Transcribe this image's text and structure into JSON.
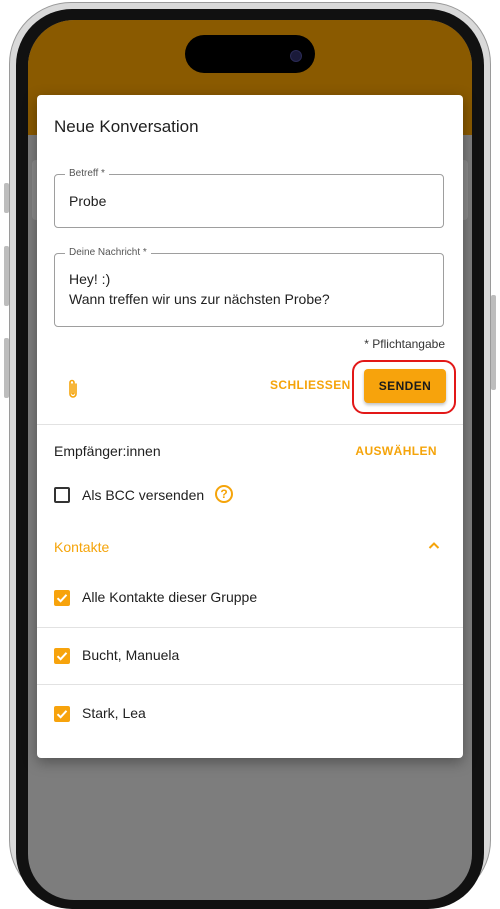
{
  "dialog": {
    "title": "Neue Konversation",
    "subject_label": "Betreff *",
    "subject_value": "Probe",
    "message_label": "Deine Nachricht *",
    "message_value": "Hey! :)\nWann treffen wir uns zur nächsten Probe?",
    "required_note": "* Pflichtangabe",
    "close_label": "SCHLIESSEN",
    "send_label": "SENDEN",
    "recipients_label": "Empfänger:innen",
    "select_label": "AUSWÄHLEN",
    "bcc_label": "Als BCC versenden",
    "help_glyph": "?",
    "contacts_title": "Kontakte",
    "contacts": [
      {
        "label": "Alle Kontakte dieser Gruppe",
        "checked": true
      },
      {
        "label": "Bucht, Manuela",
        "checked": true
      },
      {
        "label": "Stark, Lea",
        "checked": true
      }
    ]
  },
  "icons": [
    "paperclip-icon",
    "help-icon",
    "chevron-up-icon",
    "check-icon"
  ],
  "colors": {
    "accent": "#f7a30c",
    "header": "#8a5a00",
    "highlight": "#e21818"
  }
}
